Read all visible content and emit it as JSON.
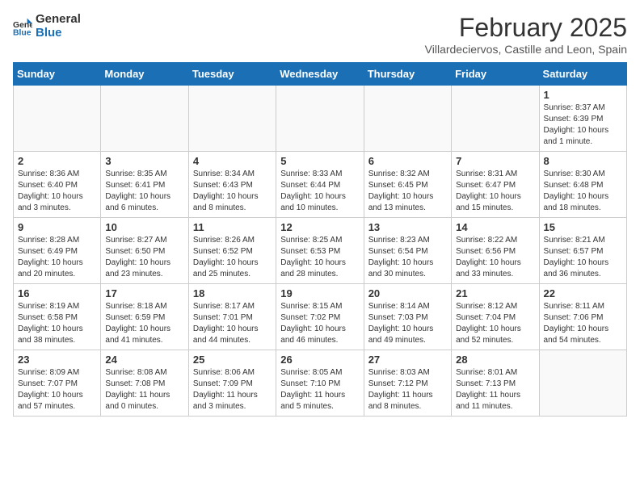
{
  "header": {
    "logo_line1": "General",
    "logo_line2": "Blue",
    "month_title": "February 2025",
    "subtitle": "Villardeciervos, Castille and Leon, Spain"
  },
  "days_of_week": [
    "Sunday",
    "Monday",
    "Tuesday",
    "Wednesday",
    "Thursday",
    "Friday",
    "Saturday"
  ],
  "weeks": [
    [
      {
        "day": "",
        "info": ""
      },
      {
        "day": "",
        "info": ""
      },
      {
        "day": "",
        "info": ""
      },
      {
        "day": "",
        "info": ""
      },
      {
        "day": "",
        "info": ""
      },
      {
        "day": "",
        "info": ""
      },
      {
        "day": "1",
        "info": "Sunrise: 8:37 AM\nSunset: 6:39 PM\nDaylight: 10 hours and 1 minute."
      }
    ],
    [
      {
        "day": "2",
        "info": "Sunrise: 8:36 AM\nSunset: 6:40 PM\nDaylight: 10 hours and 3 minutes."
      },
      {
        "day": "3",
        "info": "Sunrise: 8:35 AM\nSunset: 6:41 PM\nDaylight: 10 hours and 6 minutes."
      },
      {
        "day": "4",
        "info": "Sunrise: 8:34 AM\nSunset: 6:43 PM\nDaylight: 10 hours and 8 minutes."
      },
      {
        "day": "5",
        "info": "Sunrise: 8:33 AM\nSunset: 6:44 PM\nDaylight: 10 hours and 10 minutes."
      },
      {
        "day": "6",
        "info": "Sunrise: 8:32 AM\nSunset: 6:45 PM\nDaylight: 10 hours and 13 minutes."
      },
      {
        "day": "7",
        "info": "Sunrise: 8:31 AM\nSunset: 6:47 PM\nDaylight: 10 hours and 15 minutes."
      },
      {
        "day": "8",
        "info": "Sunrise: 8:30 AM\nSunset: 6:48 PM\nDaylight: 10 hours and 18 minutes."
      }
    ],
    [
      {
        "day": "9",
        "info": "Sunrise: 8:28 AM\nSunset: 6:49 PM\nDaylight: 10 hours and 20 minutes."
      },
      {
        "day": "10",
        "info": "Sunrise: 8:27 AM\nSunset: 6:50 PM\nDaylight: 10 hours and 23 minutes."
      },
      {
        "day": "11",
        "info": "Sunrise: 8:26 AM\nSunset: 6:52 PM\nDaylight: 10 hours and 25 minutes."
      },
      {
        "day": "12",
        "info": "Sunrise: 8:25 AM\nSunset: 6:53 PM\nDaylight: 10 hours and 28 minutes."
      },
      {
        "day": "13",
        "info": "Sunrise: 8:23 AM\nSunset: 6:54 PM\nDaylight: 10 hours and 30 minutes."
      },
      {
        "day": "14",
        "info": "Sunrise: 8:22 AM\nSunset: 6:56 PM\nDaylight: 10 hours and 33 minutes."
      },
      {
        "day": "15",
        "info": "Sunrise: 8:21 AM\nSunset: 6:57 PM\nDaylight: 10 hours and 36 minutes."
      }
    ],
    [
      {
        "day": "16",
        "info": "Sunrise: 8:19 AM\nSunset: 6:58 PM\nDaylight: 10 hours and 38 minutes."
      },
      {
        "day": "17",
        "info": "Sunrise: 8:18 AM\nSunset: 6:59 PM\nDaylight: 10 hours and 41 minutes."
      },
      {
        "day": "18",
        "info": "Sunrise: 8:17 AM\nSunset: 7:01 PM\nDaylight: 10 hours and 44 minutes."
      },
      {
        "day": "19",
        "info": "Sunrise: 8:15 AM\nSunset: 7:02 PM\nDaylight: 10 hours and 46 minutes."
      },
      {
        "day": "20",
        "info": "Sunrise: 8:14 AM\nSunset: 7:03 PM\nDaylight: 10 hours and 49 minutes."
      },
      {
        "day": "21",
        "info": "Sunrise: 8:12 AM\nSunset: 7:04 PM\nDaylight: 10 hours and 52 minutes."
      },
      {
        "day": "22",
        "info": "Sunrise: 8:11 AM\nSunset: 7:06 PM\nDaylight: 10 hours and 54 minutes."
      }
    ],
    [
      {
        "day": "23",
        "info": "Sunrise: 8:09 AM\nSunset: 7:07 PM\nDaylight: 10 hours and 57 minutes."
      },
      {
        "day": "24",
        "info": "Sunrise: 8:08 AM\nSunset: 7:08 PM\nDaylight: 11 hours and 0 minutes."
      },
      {
        "day": "25",
        "info": "Sunrise: 8:06 AM\nSunset: 7:09 PM\nDaylight: 11 hours and 3 minutes."
      },
      {
        "day": "26",
        "info": "Sunrise: 8:05 AM\nSunset: 7:10 PM\nDaylight: 11 hours and 5 minutes."
      },
      {
        "day": "27",
        "info": "Sunrise: 8:03 AM\nSunset: 7:12 PM\nDaylight: 11 hours and 8 minutes."
      },
      {
        "day": "28",
        "info": "Sunrise: 8:01 AM\nSunset: 7:13 PM\nDaylight: 11 hours and 11 minutes."
      },
      {
        "day": "",
        "info": ""
      }
    ]
  ]
}
